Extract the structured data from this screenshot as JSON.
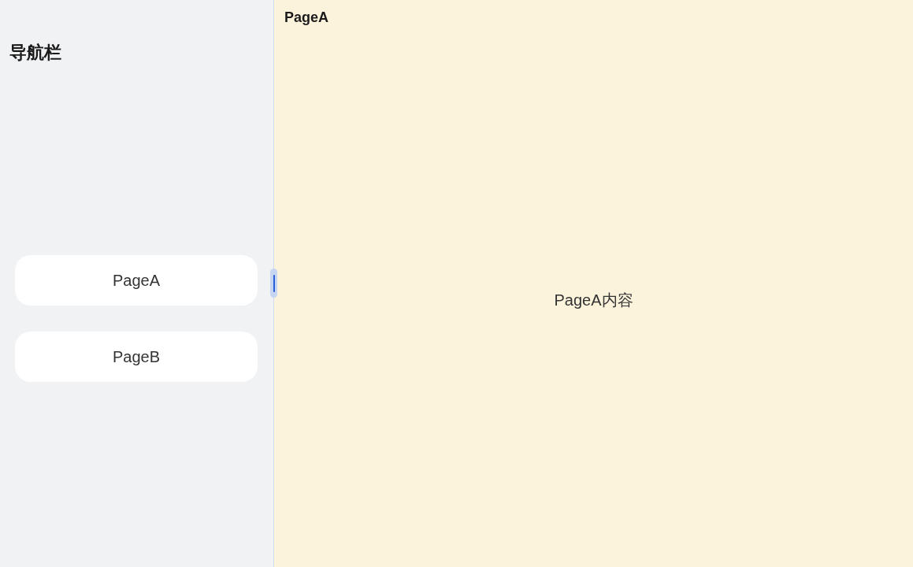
{
  "sidebar": {
    "title": "导航栏",
    "items": [
      {
        "label": "PageA"
      },
      {
        "label": "PageB"
      }
    ]
  },
  "content": {
    "title": "PageA",
    "body": "PageA内容"
  }
}
